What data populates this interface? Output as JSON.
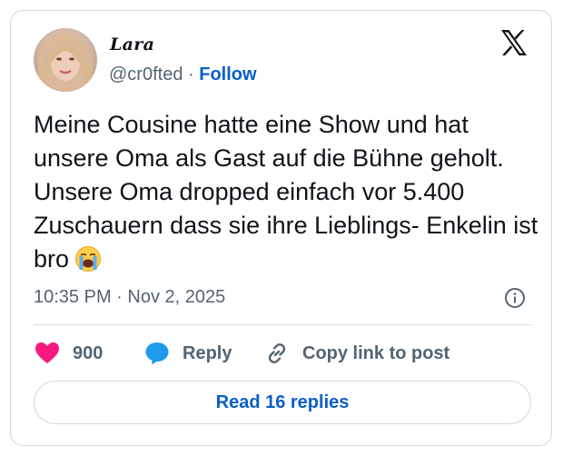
{
  "author": {
    "display_name": "Lara",
    "handle": "@cr0fted",
    "separator": "·",
    "follow_label": "Follow"
  },
  "tweet": {
    "text": "Meine Cousine hatte eine Show und hat unsere Oma als Gast auf die Bühne geholt. Unsere Oma dropped einfach vor 5.400 Zuschauern dass sie ihre Lieblings- Enkelin ist bro",
    "emoji": "loudly-crying-face",
    "timestamp": "10:35 PM · Nov 2, 2025"
  },
  "actions": {
    "like_count": "900",
    "reply_label": "Reply",
    "copy_label": "Copy link to post"
  },
  "read_replies_label": "Read 16 replies",
  "colors": {
    "link_blue": "#0b5ec7",
    "heart_pink": "#f91880",
    "reply_blue": "#1d9bf0",
    "muted_gray": "#536471",
    "border": "#cfd9de"
  },
  "icons": [
    "x-logo-icon",
    "info-icon",
    "heart-icon",
    "reply-bubble-icon",
    "link-icon"
  ]
}
